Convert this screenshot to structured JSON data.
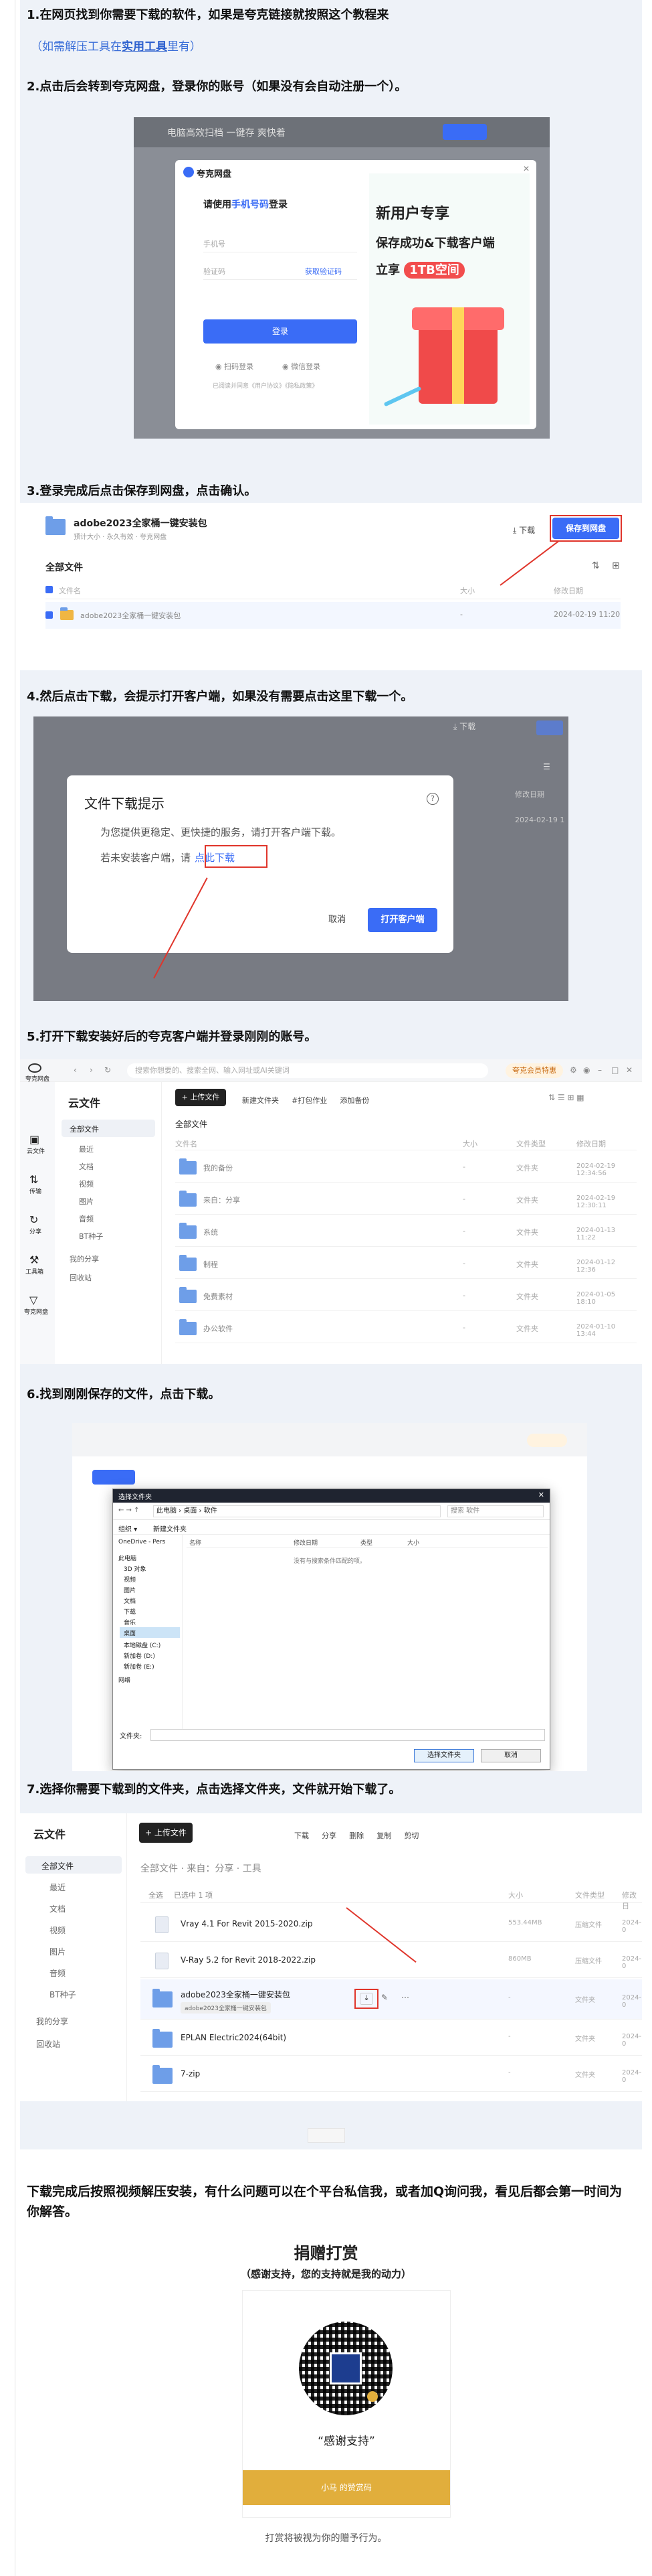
{
  "steps": {
    "s1": "1.在网页找到你需要下载的软件，如果是夸克链接就按照这个教程来",
    "s1_hint_pre": "（如需解压工具在",
    "s1_hint_link": "实用工具",
    "s1_hint_post": "里有）",
    "s2": "2.点击后会转到夸克网盘，登录你的账号（如果没有会自动注册一个）。",
    "s3": "3.登录完成后点击保存到网盘，点击确认。",
    "s4": "4.然后点击下载，会提示打开客户端，如果没有需要点击这里下载一个。",
    "s5": "5.打开下载安装好后的夸克客户端并登录刚刚的账号。",
    "s6": "6.找到刚刚保存的文件，点击下载。",
    "s7": "7.选择你需要下载到的文件夹，点击选择文件夹，文件就开始下载了。"
  },
  "login": {
    "banner": "电脑高效扫档 一键存 爽快着",
    "brand": "夸克网盘",
    "title_pre": "请使用",
    "title_link": "手机号码",
    "title_post": "登录",
    "phone_placeholder": "手机号",
    "code_placeholder": "验证码",
    "get_code": "获取验证码",
    "login_btn": "登录",
    "alt1": "扫码登录",
    "alt2": "微信登录",
    "agree": "已阅读并同意《用户协议》《隐私政策》",
    "promo1": "新用户专享",
    "promo2": "保存成功&下载客户端",
    "promo3_pre": "立享",
    "promo3_badge": "1TB空间"
  },
  "save": {
    "file_title": "adobe2023全家桶一键安装包",
    "meta": "预计大小 · 永久有效 · 夸克网盘",
    "download": "下载",
    "save_btn": "保存到网盘",
    "all_files": "全部文件",
    "col_name": "文件名",
    "col_size": "大小",
    "col_date": "修改日期",
    "row_name": "adobe2023全家桶一键安装包",
    "row_size": "-",
    "row_date": "2024-02-19 11:20"
  },
  "dialog": {
    "title": "文件下载提示",
    "line1": "为您提供更稳定、更快捷的服务，请打开客户端下载。",
    "line2_pre": "若未安装客户端，请",
    "line2_link": "点此下载",
    "cancel": "取消",
    "open": "打开客户端",
    "bg_download": "下载",
    "bg_date_col": "修改日期",
    "bg_date": "2024-02-19 1"
  },
  "client": {
    "app": "夸克网盘",
    "search_placeholder": "搜索你想要的、搜索全网、输入网址或AI关键词",
    "vip": "夸克会员特惠",
    "title": "云文件",
    "upload": "+ 上传文件",
    "toolbar": [
      "新建文件夹",
      "#打包作业",
      "添加备份"
    ],
    "crumb": "全部文件",
    "col_name": "文件名",
    "col_size": "大小",
    "col_type": "文件类型",
    "col_date": "修改日期",
    "left_nav": [
      "云文件",
      "传输",
      "分享",
      "工具箱",
      "夸克网盘"
    ],
    "side": [
      "全部文件",
      "最近",
      "文档",
      "视频",
      "图片",
      "音频",
      "BT种子",
      "我的分享",
      "回收站"
    ],
    "rows": [
      {
        "name": "我的备份",
        "size": "-",
        "type": "文件夹",
        "date": "2024-02-19 12:34:56"
      },
      {
        "name": "来自：分享",
        "size": "-",
        "type": "文件夹",
        "date": "2024-02-19 12:30:11"
      },
      {
        "name": "系统",
        "size": "-",
        "type": "文件夹",
        "date": "2024-01-13 11:22"
      },
      {
        "name": "制程",
        "size": "-",
        "type": "文件夹",
        "date": "2024-01-12 12:36"
      },
      {
        "name": "免费素材",
        "size": "-",
        "type": "文件夹",
        "date": "2024-01-05 18:10"
      },
      {
        "name": "办公软件",
        "size": "-",
        "type": "文件夹",
        "date": "2024-01-10 13:44"
      }
    ]
  },
  "picker": {
    "title": "选择文件夹",
    "path": "此电脑 › 桌面 › 软件",
    "search": "搜索 软件",
    "organize": "组织 ▾",
    "new_folder": "新建文件夹",
    "col_name": "名称",
    "col_date": "修改日期",
    "col_type": "类型",
    "col_size": "大小",
    "empty": "没有与搜索条件匹配的项。",
    "tree": [
      "OneDrive - Pers",
      "此电脑",
      "3D 对象",
      "视频",
      "图片",
      "文档",
      "下载",
      "音乐",
      "桌面",
      "本地磁盘 (C:)",
      "新加卷 (D:)",
      "新加卷 (E:)",
      "网络"
    ],
    "folder_label": "文件夹:",
    "select": "选择文件夹",
    "cancel": "取消"
  },
  "browser": {
    "title": "云文件",
    "upload": "+ 上传文件",
    "toolbar": [
      "下载",
      "分享",
      "删除",
      "复制",
      "剪切"
    ],
    "crumb": "全部文件 · 来自：分享 · 工具",
    "select_all": "全选",
    "selected": "已选中 1 项",
    "col_size": "大小",
    "col_type": "文件类型",
    "col_date": "修改日",
    "side": [
      "全部文件",
      "最近",
      "文档",
      "视频",
      "图片",
      "音频",
      "BT种子",
      "我的分享",
      "回收站"
    ],
    "rows": [
      {
        "name": "Vray 4.1 For Revit 2015-2020.zip",
        "size": "553.44MB",
        "type": "压缩文件",
        "date": "2024-0"
      },
      {
        "name": "V-Ray 5.2 for Revit 2018-2022.zip",
        "size": "860MB",
        "type": "压缩文件",
        "date": "2024-0"
      },
      {
        "name": "adobe2023全家桶一键安装包",
        "size": "-",
        "type": "文件夹",
        "date": "2024-0"
      },
      {
        "name": "EPLAN Electric2024(64bit)",
        "size": "-",
        "type": "文件夹",
        "date": "2024-0"
      },
      {
        "name": "7-zip",
        "size": "-",
        "type": "文件夹",
        "date": "2024-0"
      }
    ],
    "tooltip": "adobe2023全家桶一键安装包"
  },
  "footer": {
    "note": "下载完成后按照视频解压安装，有什么问题可以在个平台私信我，或者加Q询问我，看见后都会第一时间为你解答。",
    "donate_title": "捐赠打赏",
    "donate_sub": "（感谢支持，您的支持就是我的动力）",
    "qr_caption": "“感谢支持”",
    "pay_label": "小马 的赞赏码",
    "footnote": "打赏将被视为你的赠予行为。"
  },
  "colors": {
    "accent": "#3a6cf6",
    "highlight": "#e0352b",
    "section_bg": "#eef2f8",
    "gold": "#e1ae3c"
  }
}
